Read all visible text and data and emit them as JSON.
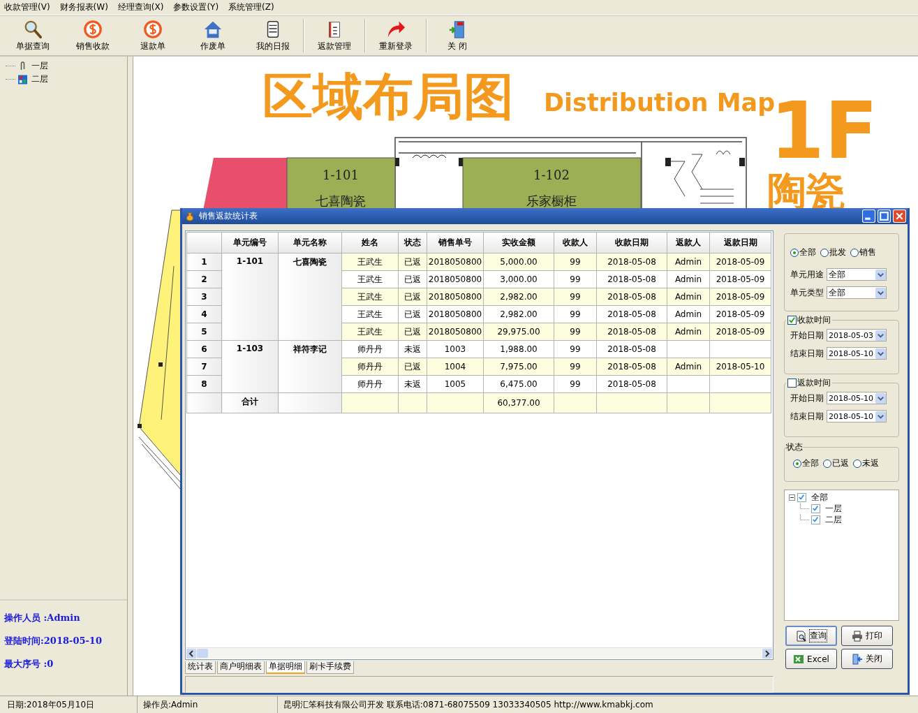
{
  "menu": [
    "收款管理(V)",
    "财务报表(W)",
    "经理查询(X)",
    "参数设置(Y)",
    "系统管理(Z)"
  ],
  "toolbar": [
    {
      "kind": "tool",
      "label": "单据查询"
    },
    {
      "kind": "tool",
      "label": "销售收款"
    },
    {
      "kind": "tool",
      "label": "退款单"
    },
    {
      "kind": "tool",
      "label": "作废单"
    },
    {
      "kind": "tool",
      "label": "我的日报"
    },
    {
      "kind": "separator"
    },
    {
      "kind": "tool",
      "label": "返款管理"
    },
    {
      "kind": "separator"
    },
    {
      "kind": "tool",
      "label": "重新登录"
    },
    {
      "kind": "separator"
    },
    {
      "kind": "tool",
      "label": "关 闭"
    }
  ],
  "sidebar": {
    "tree": [
      {
        "label": "一层"
      },
      {
        "label": "二层"
      }
    ],
    "info": [
      "操作人员 :Admin",
      "登陆时间:2018-05-10",
      "最大序号 :0"
    ]
  },
  "map": {
    "title": "区域布局图",
    "subtitle": "Distribution Map",
    "floor": "1F",
    "category": "陶瓷",
    "rooms": [
      {
        "number": "1-101",
        "name": "七喜陶瓷"
      },
      {
        "number": "1-102",
        "name": "乐家橱柜"
      }
    ]
  },
  "dialog": {
    "title": "销售返款统计表",
    "table": {
      "columns": [
        "单元编号",
        "单元名称",
        "姓名",
        "状态",
        "销售单号",
        "实收金额",
        "收款人",
        "收款日期",
        "返款人",
        "返款日期"
      ],
      "groups": [
        {
          "unit_no": "1-101",
          "unit_name": "七喜陶瓷",
          "rows": [
            {
              "index": "1",
              "name": "王武生",
              "status": "已返",
              "order_no": "2018050800",
              "amount": "5,000.00",
              "collector": "99",
              "collect_date": "2018-05-08",
              "refunder": "Admin",
              "refund_date": "2018-05-09"
            },
            {
              "index": "2",
              "name": "王武生",
              "status": "已返",
              "order_no": "2018050800",
              "amount": "3,000.00",
              "collector": "99",
              "collect_date": "2018-05-08",
              "refunder": "Admin",
              "refund_date": "2018-05-09"
            },
            {
              "index": "3",
              "name": "王武生",
              "status": "已返",
              "order_no": "2018050800",
              "amount": "2,982.00",
              "collector": "99",
              "collect_date": "2018-05-08",
              "refunder": "Admin",
              "refund_date": "2018-05-09"
            },
            {
              "index": "4",
              "name": "王武生",
              "status": "已返",
              "order_no": "2018050800",
              "amount": "2,982.00",
              "collector": "99",
              "collect_date": "2018-05-08",
              "refunder": "Admin",
              "refund_date": "2018-05-09"
            },
            {
              "index": "5",
              "name": "王武生",
              "status": "已返",
              "order_no": "2018050800",
              "amount": "29,975.00",
              "collector": "99",
              "collect_date": "2018-05-08",
              "refunder": "Admin",
              "refund_date": "2018-05-09"
            }
          ]
        },
        {
          "unit_no": "1-103",
          "unit_name": "祥符李记",
          "rows": [
            {
              "index": "6",
              "name": "师丹丹",
              "status": "未返",
              "order_no": "1003",
              "amount": "1,988.00",
              "collector": "99",
              "collect_date": "2018-05-08"
            },
            {
              "index": "7",
              "name": "师丹丹",
              "status": "已返",
              "order_no": "1004",
              "amount": "7,975.00",
              "collector": "99",
              "collect_date": "2018-05-08",
              "refunder": "Admin",
              "refund_date": "2018-05-10"
            },
            {
              "index": "8",
              "name": "师丹丹",
              "status": "未返",
              "order_no": "1005",
              "amount": "6,475.00",
              "collector": "99",
              "collect_date": "2018-05-08"
            }
          ]
        }
      ],
      "total": {
        "label": "合计",
        "amount": "60,377.00"
      }
    },
    "tabs": [
      {
        "label": "统计表",
        "selected": false
      },
      {
        "label": "商户明细表",
        "selected": false
      },
      {
        "label": "单据明细",
        "selected": true
      },
      {
        "label": "刷卡手续费",
        "selected": false
      }
    ],
    "sale_type": [
      {
        "label": "全部",
        "selected": true
      },
      {
        "label": "批发",
        "selected": false
      },
      {
        "label": "销售",
        "selected": false
      }
    ],
    "selects": [
      {
        "label": "单元用途",
        "value": "全部"
      },
      {
        "label": "单元类型",
        "value": "全部"
      }
    ],
    "date_groups": [
      {
        "label": "收款时间",
        "checked": true,
        "fields": [
          {
            "label": "开始日期",
            "value": "2018-05-03"
          },
          {
            "label": "结束日期",
            "value": "2018-05-10"
          }
        ]
      },
      {
        "label": "返款时间",
        "checked": false,
        "fields": [
          {
            "label": "开始日期",
            "value": "2018-05-10"
          },
          {
            "label": "结束日期",
            "value": "2018-05-10"
          }
        ]
      }
    ],
    "status": {
      "label": "状态",
      "options": [
        {
          "label": "全部",
          "selected": true
        },
        {
          "label": "已返",
          "selected": false
        },
        {
          "label": "未返",
          "selected": false
        }
      ]
    },
    "floor_tree": {
      "label": "全部",
      "checked": true,
      "expanded": true,
      "children": [
        {
          "label": "一层",
          "checked": true
        },
        {
          "label": "二层",
          "checked": true
        }
      ]
    },
    "buttons": [
      {
        "label": "查询",
        "focused": true
      },
      {
        "label": "打印",
        "focused": false
      },
      {
        "label": "Excel",
        "focused": false
      },
      {
        "label": "关闭",
        "focused": false
      }
    ]
  },
  "status_bar": [
    "日期:2018年05月10日",
    "操作员:Admin",
    "昆明汇笨科技有限公司开发 联系电话:0871-68075509 13033340505 http://www.kmabkj.com"
  ]
}
